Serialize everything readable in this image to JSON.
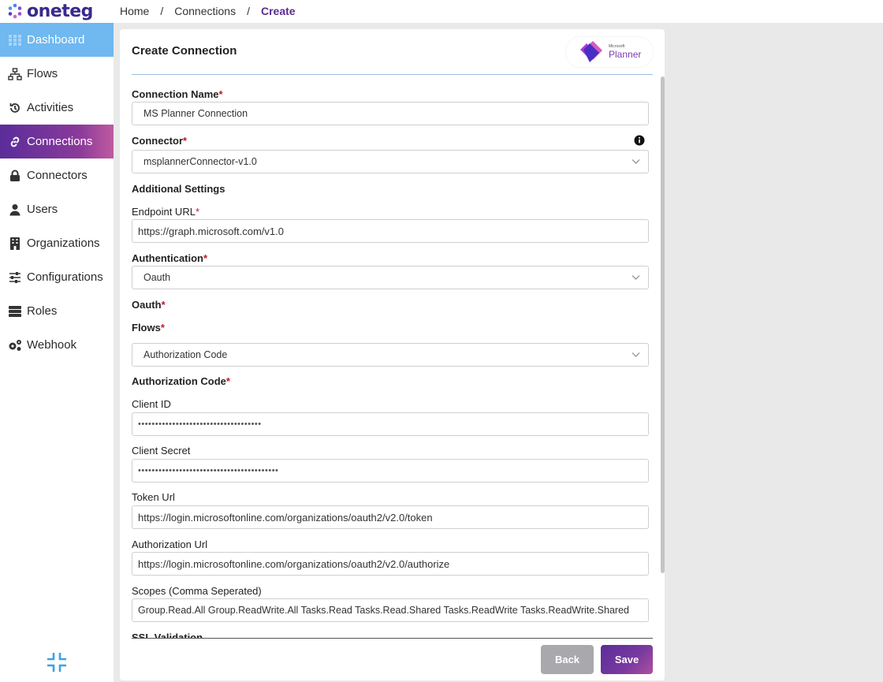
{
  "brand": {
    "name": "oneteg"
  },
  "breadcrumb": {
    "home": "Home",
    "sep": "/",
    "connections": "Connections",
    "current": "Create"
  },
  "sidebar": {
    "items": [
      {
        "label": "Dashboard",
        "icon": "grid-icon"
      },
      {
        "label": "Flows",
        "icon": "sitemap-icon"
      },
      {
        "label": "Activities",
        "icon": "history-icon"
      },
      {
        "label": "Connections",
        "icon": "link-icon"
      },
      {
        "label": "Connectors",
        "icon": "lock-icon"
      },
      {
        "label": "Users",
        "icon": "user-icon"
      },
      {
        "label": "Organizations",
        "icon": "building-icon"
      },
      {
        "label": "Configurations",
        "icon": "sliders-icon"
      },
      {
        "label": "Roles",
        "icon": "server-icon"
      },
      {
        "label": "Webhook",
        "icon": "gears-icon"
      }
    ],
    "active": "Connections"
  },
  "card": {
    "title": "Create Connection",
    "planner_logo": {
      "microsoft": "Microsoft",
      "product": "Planner"
    }
  },
  "form": {
    "connection_name": {
      "label": "Connection Name",
      "value": "MS Planner Connection"
    },
    "connector": {
      "label": "Connector",
      "value": "msplannerConnector-v1.0"
    },
    "additional_settings": "Additional Settings",
    "endpoint_url": {
      "label": "Endpoint URL",
      "value": "https://graph.microsoft.com/v1.0"
    },
    "authentication": {
      "label": "Authentication",
      "value": "Oauth"
    },
    "oauth_heading": "Oauth",
    "flows": {
      "label": "Flows",
      "value": "Authorization Code"
    },
    "authorization_code_heading": "Authorization Code",
    "client_id": {
      "label": "Client ID",
      "value": "••••••••••••••••••••••••••••••••••••"
    },
    "client_secret": {
      "label": "Client Secret",
      "value": "•••••••••••••••••••••••••••••••••••••••••"
    },
    "token_url": {
      "label": "Token Url",
      "value": "https://login.microsoftonline.com/organizations/oauth2/v2.0/token"
    },
    "authorization_url": {
      "label": "Authorization Url",
      "value": "https://login.microsoftonline.com/organizations/oauth2/v2.0/authorize"
    },
    "scopes": {
      "label": "Scopes (Comma Seperated)",
      "value": "Group.Read.All Group.ReadWrite.All Tasks.Read Tasks.Read.Shared Tasks.ReadWrite Tasks.ReadWrite.Shared"
    },
    "ssl_validation": "SSL Validation",
    "required_mark": "*"
  },
  "buttons": {
    "back": "Back",
    "save": "Save"
  },
  "colors": {
    "accent": "#5a2d9a",
    "dashboard": "#6fb8f0",
    "required": "#c0182b"
  }
}
